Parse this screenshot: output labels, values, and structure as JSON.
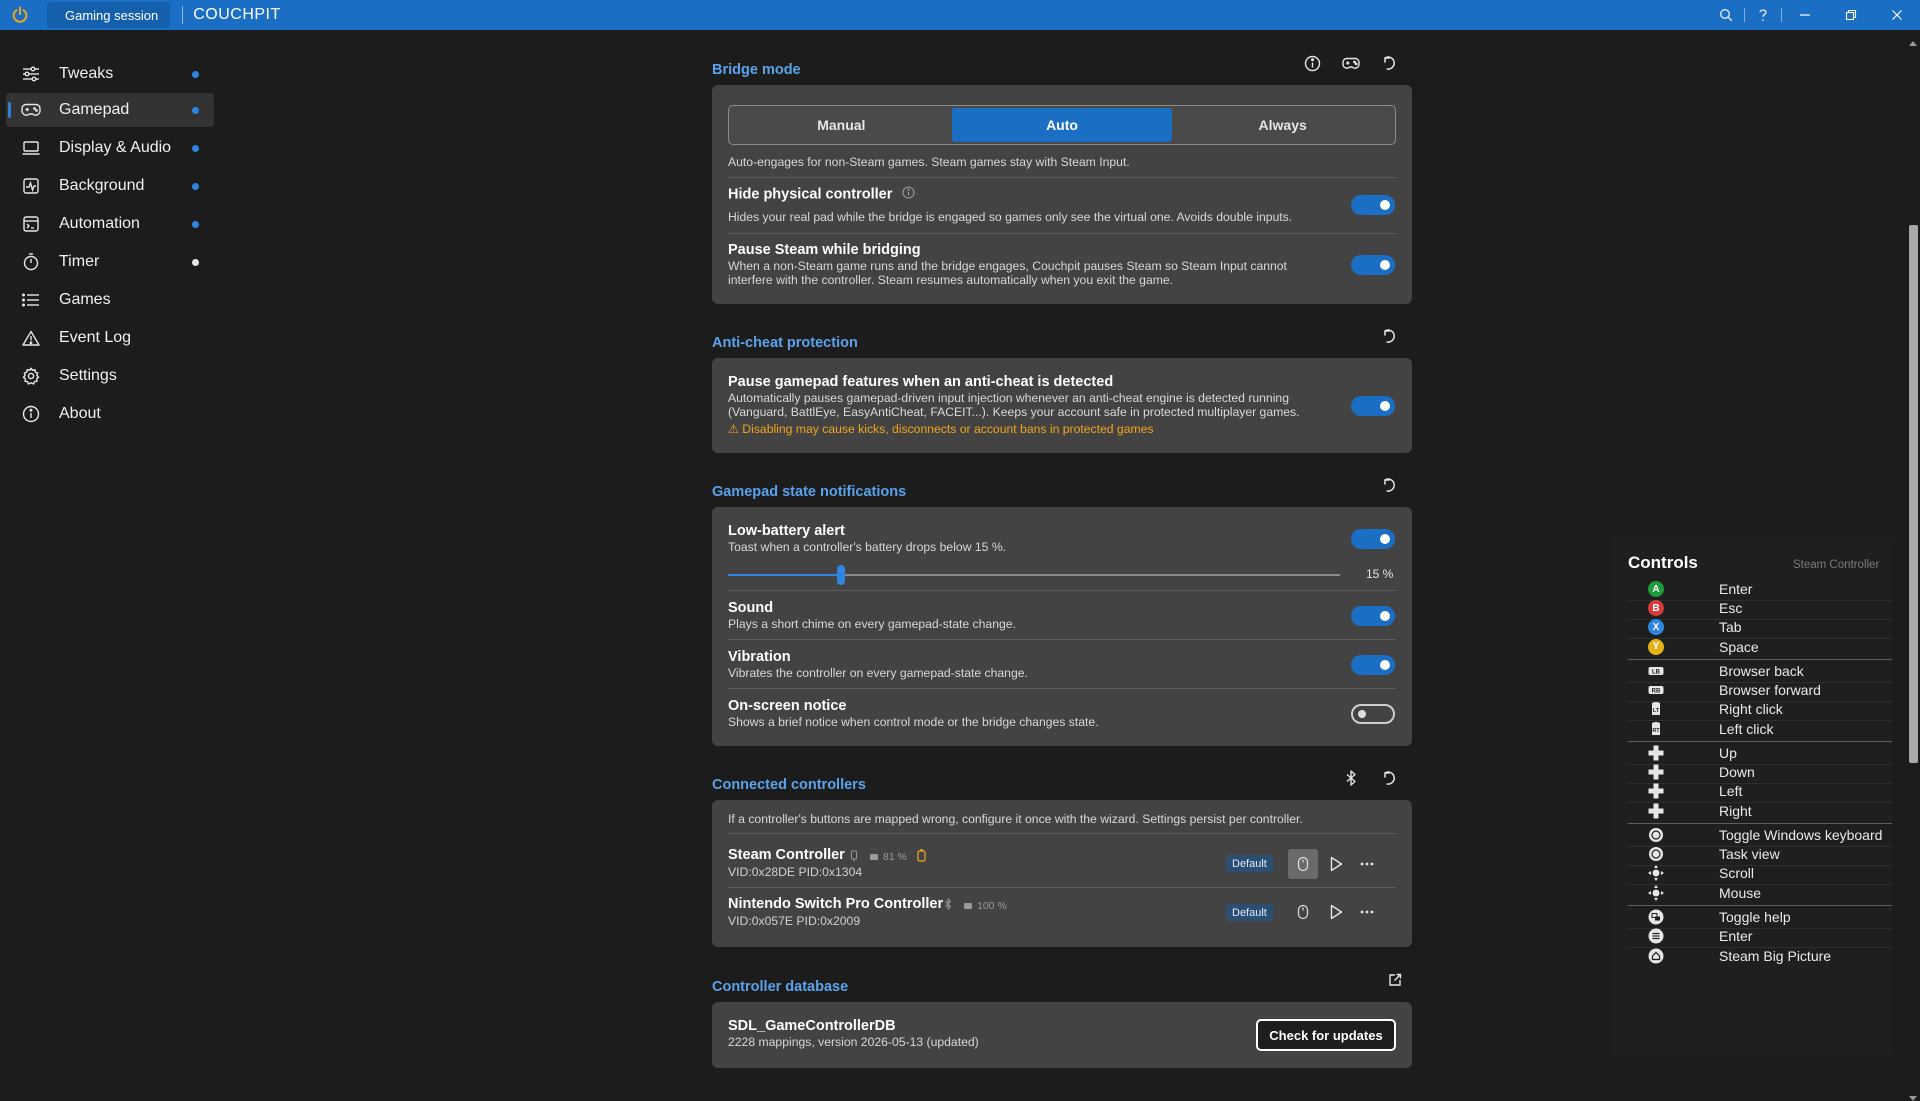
{
  "titlebar": {
    "session_label": "Gaming session",
    "app_title": "COUCHPIT",
    "icons": [
      "power-icon",
      "search-icon",
      "help-icon",
      "minimize-icon",
      "restore-icon",
      "close-icon"
    ],
    "accent": "#1a6fc4"
  },
  "sidebar": {
    "items": [
      {
        "label": "Tweaks",
        "icon": "sliders-icon",
        "dot": "blue"
      },
      {
        "label": "Gamepad",
        "icon": "gamepad-icon",
        "dot": "blue",
        "active": true
      },
      {
        "label": "Display & Audio",
        "icon": "monitor-icon",
        "dot": "blue"
      },
      {
        "label": "Background",
        "icon": "activity-icon",
        "dot": "blue"
      },
      {
        "label": "Automation",
        "icon": "automation-icon",
        "dot": "blue"
      },
      {
        "label": "Timer",
        "icon": "timer-icon",
        "dot": "white"
      },
      {
        "label": "Games",
        "icon": "list-icon"
      },
      {
        "label": "Event Log",
        "icon": "warning-icon"
      },
      {
        "label": "Settings",
        "icon": "gear-icon"
      },
      {
        "label": "About",
        "icon": "info-icon"
      }
    ]
  },
  "bridge": {
    "title": "Bridge mode",
    "modes": [
      "Manual",
      "Auto",
      "Always"
    ],
    "selected_mode": "Auto",
    "mode_desc": "Auto-engages for non-Steam games. Steam games stay with Steam Input.",
    "hide_title": "Hide physical controller",
    "hide_desc": "Hides your real pad while the bridge is engaged so games only see the virtual one. Avoids double inputs.",
    "hide_on": true,
    "pause_title": "Pause Steam while bridging",
    "pause_desc_1": "When a non-Steam game runs and the bridge engages, Couchpit pauses Steam so Steam Input cannot",
    "pause_desc_2": "interfere with the controller. Steam resumes automatically when you exit the game.",
    "pause_on": true
  },
  "anticheat": {
    "title": "Anti-cheat protection",
    "row_title": "Pause gamepad features when an anti-cheat is detected",
    "desc_1": "Automatically pauses gamepad-driven input injection whenever an anti-cheat engine is detected running",
    "desc_2": "(Vanguard, BattlEye, EasyAntiCheat, FACEIT...). Keeps your account safe in protected multiplayer games.",
    "warning": "⚠ Disabling may cause kicks, disconnects or account bans in protected games",
    "on": true,
    "warning_color": "#f0a51c"
  },
  "notifications": {
    "title": "Gamepad state notifications",
    "low_battery_title": "Low-battery alert",
    "low_battery_desc": "Toast when a controller's battery drops below 15 %.",
    "low_battery_on": true,
    "threshold_value": "15 %",
    "threshold_fraction": 0.15,
    "sound_title": "Sound",
    "sound_desc": "Plays a short chime on every gamepad-state change.",
    "sound_on": true,
    "vibration_title": "Vibration",
    "vibration_desc": "Vibrates the controller on every gamepad-state change.",
    "vibration_on": true,
    "notice_title": "On-screen notice",
    "notice_desc": "Shows a brief notice when control mode or the bridge changes state.",
    "notice_on": false
  },
  "connected": {
    "title": "Connected controllers",
    "hint": "If a controller's buttons are mapped wrong, configure it once with the wizard. Settings persist per controller.",
    "controllers": [
      {
        "name": "Steam Controller",
        "battery": "81 %",
        "ids": "VID:0x28DE  PID:0x1304",
        "profile": "Default"
      },
      {
        "name": "Nintendo Switch Pro Controller",
        "battery": "100 %",
        "ids": "VID:0x057E  PID:0x2009",
        "profile": "Default"
      }
    ]
  },
  "database": {
    "title": "Controller database",
    "name": "SDL_GameControllerDB",
    "info": "2228 mappings, version 2026-05-13 (updated)",
    "button": "Check for updates"
  },
  "controls": {
    "title": "Controls",
    "subtitle": "Steam Controller",
    "groups": [
      [
        {
          "icon": "A",
          "color": "#1f9b3c",
          "label": "Enter"
        },
        {
          "icon": "B",
          "color": "#d83a3a",
          "label": "Esc"
        },
        {
          "icon": "X",
          "color": "#2f86e2",
          "label": "Tab"
        },
        {
          "icon": "Y",
          "color": "#e3b21a",
          "label": "Space"
        }
      ],
      [
        {
          "icon": "LB",
          "label": "Browser back"
        },
        {
          "icon": "RB",
          "label": "Browser forward"
        },
        {
          "icon": "LT",
          "label": "Right click"
        },
        {
          "icon": "RT",
          "label": "Left click"
        }
      ],
      [
        {
          "icon": "dpad",
          "label": "Up"
        },
        {
          "icon": "dpad",
          "label": "Down"
        },
        {
          "icon": "dpad",
          "label": "Left"
        },
        {
          "icon": "dpad",
          "label": "Right"
        }
      ],
      [
        {
          "icon": "stick",
          "label": "Toggle Windows keyboard"
        },
        {
          "icon": "stick",
          "label": "Task view"
        },
        {
          "icon": "move",
          "label": "Scroll"
        },
        {
          "icon": "move",
          "label": "Mouse"
        }
      ],
      [
        {
          "icon": "view",
          "label": "Toggle help"
        },
        {
          "icon": "menu",
          "label": "Enter"
        },
        {
          "icon": "home",
          "label": "Steam Big Picture"
        }
      ]
    ]
  }
}
